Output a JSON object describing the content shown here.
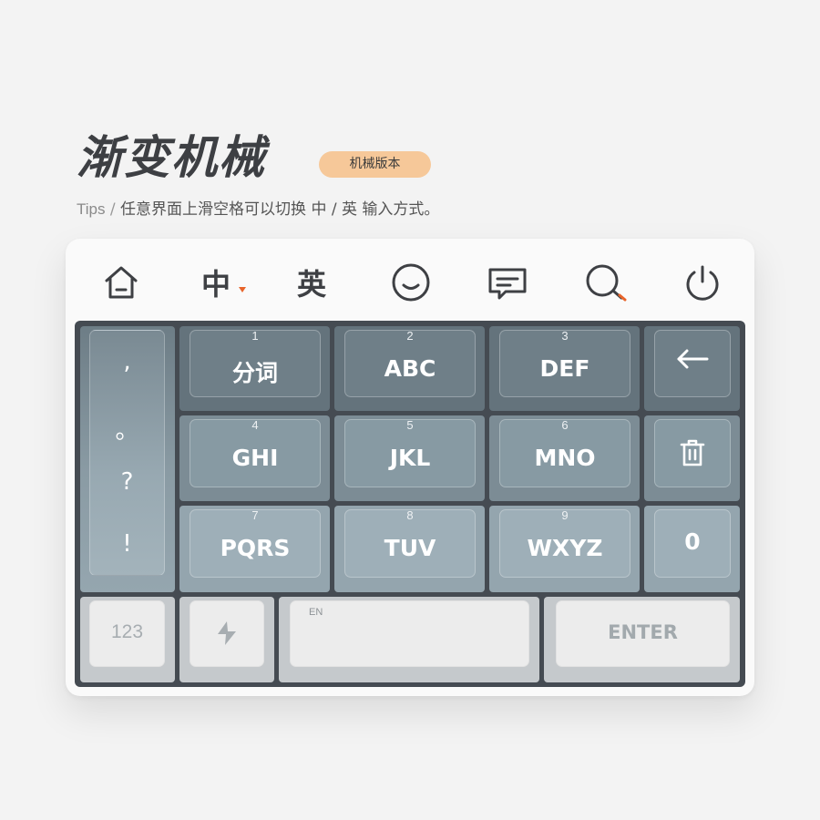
{
  "header": {
    "title": "渐变机械",
    "badge": "机械版本",
    "tips_prefix": "Tips",
    "tips_sep": " / ",
    "tips_text": "任意界面上滑空格可以切换 中 / 英 输入方式。"
  },
  "toolbar": {
    "icons": [
      "home-icon",
      "smile-icon",
      "message-icon",
      "search-icon",
      "power-icon"
    ],
    "lang_zh": "中",
    "lang_en": "英"
  },
  "keyboard": {
    "punctuation": [
      ",",
      "。",
      "?",
      "!"
    ],
    "rows": [
      [
        {
          "num": "1",
          "label": "分词"
        },
        {
          "num": "2",
          "label": "ABC"
        },
        {
          "num": "3",
          "label": "DEF"
        }
      ],
      [
        {
          "num": "4",
          "label": "GHI"
        },
        {
          "num": "5",
          "label": "JKL"
        },
        {
          "num": "6",
          "label": "MNO"
        }
      ],
      [
        {
          "num": "7",
          "label": "PQRS"
        },
        {
          "num": "8",
          "label": "TUV"
        },
        {
          "num": "9",
          "label": "WXYZ"
        }
      ]
    ],
    "side_keys": {
      "backspace_icon": "arrow-left-icon",
      "clear_icon": "trash-icon",
      "zero": "0"
    },
    "bottom": {
      "numbers": "123",
      "symbol_icon": "lightning-icon",
      "space_hint": "EN",
      "enter": "ENTER"
    }
  },
  "colors": {
    "accent": "#f6c899",
    "caret": "#e8642a",
    "board": "#454b52",
    "text_dark": "#3d3f43"
  }
}
